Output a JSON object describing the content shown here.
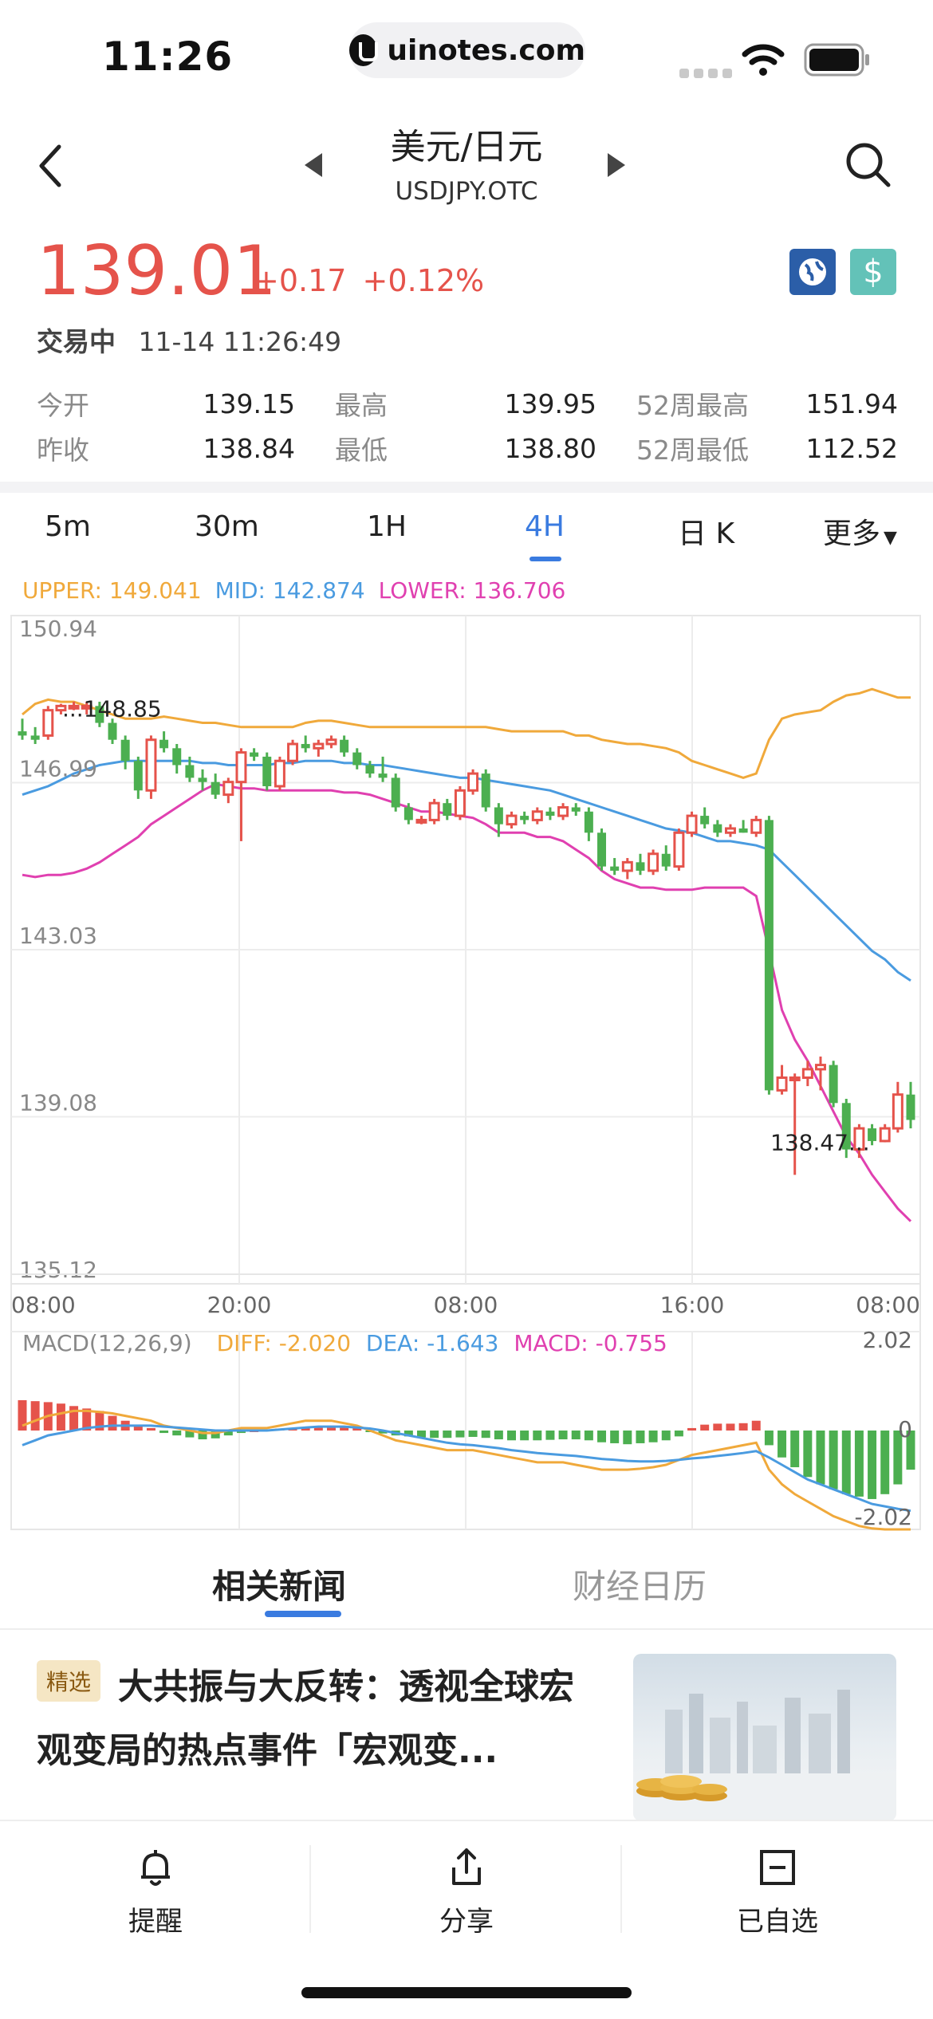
{
  "status_bar": {
    "time": "11:26",
    "url": "uinotes.com"
  },
  "header": {
    "title": "美元/日元",
    "subtitle": "USDJPY.OTC"
  },
  "quote": {
    "price": "139.01",
    "change": "+0.17",
    "change_pct": "+0.12%",
    "status": "交易中",
    "datetime": "11-14 11:26:49"
  },
  "stats": [
    [
      {
        "label": "今开",
        "value": "139.15"
      },
      {
        "label": "最高",
        "value": "139.95"
      },
      {
        "label": "52周最高",
        "value": "151.94"
      }
    ],
    [
      {
        "label": "昨收",
        "value": "138.84"
      },
      {
        "label": "最低",
        "value": "138.80"
      },
      {
        "label": "52周最低",
        "value": "112.52"
      }
    ]
  ],
  "period_tabs": [
    "5m",
    "30m",
    "1H",
    "4H",
    "日 K",
    "更多"
  ],
  "active_period": "4H",
  "boll": {
    "upper": "UPPER: 149.041",
    "mid": "MID: 142.874",
    "lower": "LOWER: 136.706"
  },
  "macd_legend": {
    "name": "MACD(12,26,9)",
    "diff": "DIFF: -2.020",
    "dea": "DEA: -1.643",
    "macd": "MACD: -0.755"
  },
  "colors": {
    "up": "#e5534b",
    "down": "#4caf50",
    "accent": "#3a7be0",
    "upper": "#f0a93b",
    "mid": "#4a9be0",
    "lower": "#e040b0"
  },
  "chart_data": {
    "type": "candlestick",
    "y_axis_labels": [
      "150.94",
      "146.99",
      "143.03",
      "139.08",
      "135.12"
    ],
    "x_axis_labels": [
      "08:00",
      "20:00",
      "08:00",
      "16:00",
      "08:00"
    ],
    "ylim": [
      135.12,
      150.94
    ],
    "annotations": [
      {
        "text": "...148.85",
        "value": 148.85
      },
      {
        "text": "138.47...",
        "value": 138.47
      }
    ],
    "candles": [
      [
        148.2,
        148.5,
        148.0,
        148.1
      ],
      [
        148.1,
        148.3,
        147.9,
        148.0
      ],
      [
        148.1,
        148.8,
        148.0,
        148.7
      ],
      [
        148.7,
        148.85,
        148.6,
        148.8
      ],
      [
        148.8,
        148.9,
        148.7,
        148.8
      ],
      [
        148.8,
        148.9,
        148.6,
        148.8
      ],
      [
        148.8,
        148.9,
        148.3,
        148.4
      ],
      [
        148.4,
        148.5,
        147.9,
        148.0
      ],
      [
        148.0,
        148.1,
        147.3,
        147.5
      ],
      [
        147.5,
        147.6,
        146.6,
        146.8
      ],
      [
        146.8,
        148.1,
        146.6,
        148.0
      ],
      [
        148.0,
        148.2,
        147.7,
        147.8
      ],
      [
        147.8,
        147.9,
        147.2,
        147.4
      ],
      [
        147.4,
        147.6,
        147.0,
        147.1
      ],
      [
        147.1,
        147.3,
        146.8,
        147.0
      ],
      [
        147.0,
        147.2,
        146.6,
        146.7
      ],
      [
        146.7,
        147.1,
        146.5,
        147.0
      ],
      [
        147.0,
        147.8,
        145.6,
        147.7
      ],
      [
        147.7,
        147.8,
        147.5,
        147.6
      ],
      [
        147.6,
        147.7,
        146.8,
        146.9
      ],
      [
        146.9,
        147.6,
        146.8,
        147.5
      ],
      [
        147.5,
        148.0,
        147.4,
        147.9
      ],
      [
        147.9,
        148.1,
        147.7,
        147.8
      ],
      [
        147.8,
        148.0,
        147.6,
        147.9
      ],
      [
        147.9,
        148.1,
        147.8,
        148.0
      ],
      [
        148.0,
        148.1,
        147.6,
        147.7
      ],
      [
        147.7,
        147.8,
        147.3,
        147.4
      ],
      [
        147.4,
        147.5,
        147.1,
        147.2
      ],
      [
        147.2,
        147.6,
        147.0,
        147.1
      ],
      [
        147.1,
        147.2,
        146.3,
        146.4
      ],
      [
        146.4,
        146.5,
        146.0,
        146.1
      ],
      [
        146.1,
        146.2,
        146.0,
        146.1
      ],
      [
        146.1,
        146.6,
        146.0,
        146.5
      ],
      [
        146.5,
        146.6,
        146.1,
        146.2
      ],
      [
        146.2,
        146.9,
        146.1,
        146.8
      ],
      [
        146.8,
        147.3,
        146.7,
        147.2
      ],
      [
        147.2,
        147.3,
        146.3,
        146.4
      ],
      [
        146.4,
        146.5,
        145.7,
        146.0
      ],
      [
        146.0,
        146.3,
        145.9,
        146.2
      ],
      [
        146.2,
        146.3,
        146.0,
        146.1
      ],
      [
        146.1,
        146.4,
        146.0,
        146.3
      ],
      [
        146.3,
        146.4,
        146.1,
        146.2
      ],
      [
        146.2,
        146.5,
        146.1,
        146.4
      ],
      [
        146.4,
        146.5,
        146.2,
        146.3
      ],
      [
        146.3,
        146.4,
        145.6,
        145.8
      ],
      [
        145.8,
        145.9,
        144.9,
        145.0
      ],
      [
        145.0,
        145.2,
        144.8,
        144.9
      ],
      [
        144.9,
        145.2,
        144.7,
        145.1
      ],
      [
        145.1,
        145.3,
        144.8,
        144.9
      ],
      [
        144.9,
        145.4,
        144.8,
        145.3
      ],
      [
        145.3,
        145.5,
        144.9,
        145.0
      ],
      [
        145.0,
        145.9,
        144.9,
        145.8
      ],
      [
        145.8,
        146.3,
        145.7,
        146.2
      ],
      [
        146.2,
        146.4,
        145.9,
        146.0
      ],
      [
        146.0,
        146.1,
        145.7,
        145.8
      ],
      [
        145.8,
        146.0,
        145.7,
        145.9
      ],
      [
        145.9,
        146.1,
        145.8,
        145.8
      ],
      [
        145.8,
        146.2,
        145.7,
        146.1
      ],
      [
        146.1,
        146.2,
        139.6,
        139.7
      ],
      [
        139.7,
        140.3,
        139.6,
        140.0
      ],
      [
        140.0,
        140.1,
        137.7,
        140.0
      ],
      [
        140.0,
        140.4,
        139.8,
        140.2
      ],
      [
        140.2,
        140.5,
        139.7,
        140.3
      ],
      [
        140.3,
        140.4,
        139.3,
        139.4
      ],
      [
        139.4,
        139.5,
        138.1,
        138.3
      ],
      [
        138.3,
        138.9,
        138.1,
        138.8
      ],
      [
        138.8,
        138.9,
        138.4,
        138.5
      ],
      [
        138.5,
        138.9,
        138.47,
        138.8
      ],
      [
        138.8,
        139.9,
        138.7,
        139.6
      ],
      [
        139.6,
        139.9,
        138.8,
        139.0
      ]
    ],
    "series": [
      {
        "name": "UPPER",
        "values": [
          148.6,
          148.85,
          148.95,
          148.9,
          148.9,
          148.8,
          148.7,
          148.6,
          148.5,
          148.5,
          148.5,
          148.55,
          148.5,
          148.45,
          148.4,
          148.4,
          148.35,
          148.3,
          148.3,
          148.3,
          148.3,
          148.3,
          148.4,
          148.45,
          148.45,
          148.4,
          148.35,
          148.3,
          148.3,
          148.3,
          148.3,
          148.3,
          148.3,
          148.3,
          148.3,
          148.3,
          148.3,
          148.25,
          148.2,
          148.2,
          148.2,
          148.2,
          148.2,
          148.1,
          148.1,
          148.0,
          147.95,
          147.9,
          147.9,
          147.85,
          147.8,
          147.7,
          147.5,
          147.4,
          147.3,
          147.2,
          147.1,
          147.2,
          148.0,
          148.5,
          148.6,
          148.65,
          148.7,
          148.9,
          149.05,
          149.1,
          149.2,
          149.1,
          149.0,
          149.0
        ]
      },
      {
        "name": "MID",
        "values": [
          146.7,
          146.8,
          146.9,
          147.05,
          147.2,
          147.3,
          147.4,
          147.45,
          147.5,
          147.5,
          147.5,
          147.5,
          147.5,
          147.5,
          147.45,
          147.45,
          147.4,
          147.4,
          147.4,
          147.4,
          147.45,
          147.45,
          147.5,
          147.5,
          147.5,
          147.45,
          147.45,
          147.4,
          147.4,
          147.35,
          147.3,
          147.25,
          147.2,
          147.15,
          147.1,
          147.1,
          147.05,
          147.0,
          146.95,
          146.9,
          146.85,
          146.8,
          146.7,
          146.6,
          146.5,
          146.4,
          146.3,
          146.2,
          146.1,
          146.0,
          145.9,
          145.85,
          145.8,
          145.7,
          145.6,
          145.6,
          145.55,
          145.5,
          145.4,
          145.1,
          144.8,
          144.5,
          144.2,
          143.9,
          143.6,
          143.3,
          143.0,
          142.8,
          142.5,
          142.3
        ]
      },
      {
        "name": "LOWER",
        "values": [
          144.8,
          144.75,
          144.8,
          144.8,
          144.85,
          144.95,
          145.1,
          145.3,
          145.5,
          145.7,
          146.0,
          146.2,
          146.4,
          146.6,
          146.8,
          146.95,
          146.9,
          146.85,
          146.85,
          146.8,
          146.8,
          146.8,
          146.8,
          146.8,
          146.8,
          146.75,
          146.75,
          146.7,
          146.6,
          146.5,
          146.4,
          146.3,
          146.3,
          146.25,
          146.2,
          146.15,
          146.0,
          145.8,
          145.8,
          145.8,
          145.7,
          145.7,
          145.6,
          145.4,
          145.2,
          144.9,
          144.7,
          144.6,
          144.5,
          144.5,
          144.45,
          144.45,
          144.45,
          144.5,
          144.5,
          144.5,
          144.5,
          144.3,
          143.0,
          141.6,
          140.9,
          140.4,
          139.8,
          139.2,
          138.6,
          138.2,
          137.7,
          137.3,
          136.9,
          136.6
        ]
      }
    ],
    "macd": {
      "ylim": [
        -2.02,
        2.02
      ],
      "y_axis_labels": [
        "2.02",
        "0",
        "-2.02"
      ],
      "histogram": [
        0.62,
        0.6,
        0.58,
        0.55,
        0.5,
        0.45,
        0.4,
        0.3,
        0.2,
        0.12,
        0.05,
        -0.05,
        -0.1,
        -0.14,
        -0.18,
        -0.16,
        -0.1,
        -0.05,
        0.0,
        0.02,
        0.04,
        0.05,
        0.06,
        0.08,
        0.1,
        0.08,
        0.05,
        -0.02,
        -0.06,
        -0.1,
        -0.12,
        -0.14,
        -0.15,
        -0.15,
        -0.14,
        -0.13,
        -0.15,
        -0.18,
        -0.2,
        -0.2,
        -0.2,
        -0.19,
        -0.18,
        -0.18,
        -0.2,
        -0.24,
        -0.26,
        -0.28,
        -0.26,
        -0.24,
        -0.2,
        -0.12,
        0.05,
        0.12,
        0.14,
        0.14,
        0.15,
        0.2,
        -0.3,
        -0.55,
        -0.75,
        -0.95,
        -1.1,
        -1.2,
        -1.3,
        -1.35,
        -1.4,
        -1.3,
        -1.1,
        -0.8
      ],
      "diff": [
        0.1,
        0.2,
        0.3,
        0.35,
        0.4,
        0.4,
        0.38,
        0.35,
        0.3,
        0.25,
        0.2,
        0.1,
        0.05,
        0.0,
        -0.05,
        -0.05,
        0.0,
        0.05,
        0.05,
        0.05,
        0.1,
        0.15,
        0.2,
        0.2,
        0.2,
        0.15,
        0.1,
        0.0,
        -0.1,
        -0.2,
        -0.25,
        -0.3,
        -0.35,
        -0.4,
        -0.4,
        -0.4,
        -0.45,
        -0.5,
        -0.55,
        -0.6,
        -0.65,
        -0.65,
        -0.65,
        -0.7,
        -0.75,
        -0.8,
        -0.8,
        -0.8,
        -0.78,
        -0.75,
        -0.7,
        -0.6,
        -0.5,
        -0.45,
        -0.4,
        -0.35,
        -0.3,
        -0.25,
        -0.8,
        -1.1,
        -1.3,
        -1.45,
        -1.6,
        -1.75,
        -1.85,
        -1.95,
        -2.0,
        -2.02,
        -2.02,
        -2.02
      ],
      "dea": [
        -0.3,
        -0.2,
        -0.1,
        -0.05,
        0.0,
        0.05,
        0.08,
        0.1,
        0.1,
        0.1,
        0.1,
        0.08,
        0.06,
        0.04,
        0.02,
        0.0,
        0.0,
        0.0,
        0.0,
        0.0,
        0.02,
        0.04,
        0.06,
        0.08,
        0.08,
        0.08,
        0.06,
        0.04,
        0.0,
        -0.05,
        -0.1,
        -0.15,
        -0.2,
        -0.25,
        -0.28,
        -0.3,
        -0.33,
        -0.36,
        -0.4,
        -0.43,
        -0.46,
        -0.48,
        -0.5,
        -0.52,
        -0.55,
        -0.58,
        -0.6,
        -0.62,
        -0.63,
        -0.63,
        -0.62,
        -0.6,
        -0.57,
        -0.55,
        -0.52,
        -0.49,
        -0.46,
        -0.42,
        -0.55,
        -0.7,
        -0.85,
        -1.0,
        -1.1,
        -1.2,
        -1.3,
        -1.4,
        -1.5,
        -1.55,
        -1.6,
        -1.64
      ]
    }
  },
  "news": {
    "tabs": [
      "相关新闻",
      "财经日历"
    ],
    "tag": "精选",
    "headline": "大共振与大反转：透视全球宏观变局的热点事件「宏观变..."
  },
  "bottom_bar": [
    "提醒",
    "分享",
    "已自选"
  ]
}
